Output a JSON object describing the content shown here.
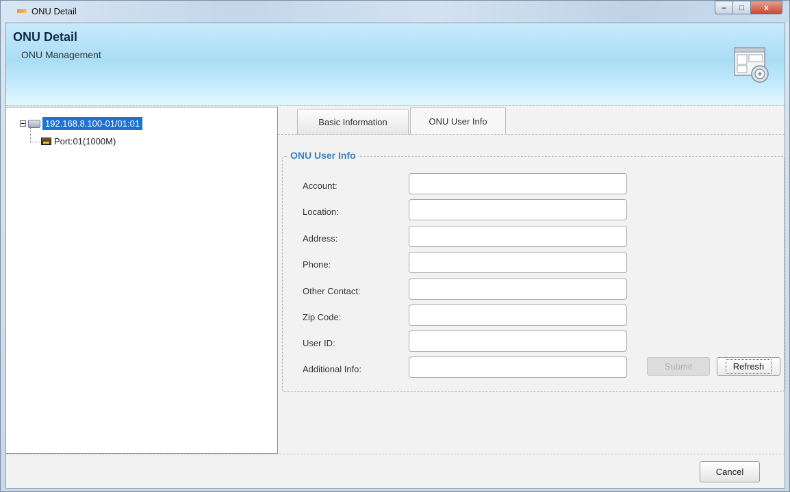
{
  "window": {
    "title": "ONU Detail",
    "controls": {
      "minimize": "–",
      "maximize": "□",
      "close": "x"
    }
  },
  "banner": {
    "title": "ONU Detail",
    "subtitle": "ONU Management",
    "icon": "window-settings-icon"
  },
  "tree": {
    "root_label": "192.168.8.100-01/01:01",
    "root_icon": "device-icon",
    "children": [
      {
        "label": "Port:01(1000M)",
        "icon": "port-icon"
      }
    ]
  },
  "tabs": [
    {
      "label": "Basic Information",
      "active": false
    },
    {
      "label": "ONU User Info",
      "active": true
    }
  ],
  "user_info": {
    "group_title": "ONU User Info",
    "fields": [
      {
        "label": "Account:",
        "value": ""
      },
      {
        "label": "Location:",
        "value": ""
      },
      {
        "label": "Address:",
        "value": ""
      },
      {
        "label": "Phone:",
        "value": ""
      },
      {
        "label": "Other Contact:",
        "value": ""
      },
      {
        "label": "Zip Code:",
        "value": ""
      },
      {
        "label": "User ID:",
        "value": ""
      },
      {
        "label": "Additional Info:",
        "value": ""
      }
    ],
    "submit_label": "Submit",
    "submit_enabled": false,
    "refresh_label": "Refresh"
  },
  "footer": {
    "cancel_label": "Cancel"
  }
}
